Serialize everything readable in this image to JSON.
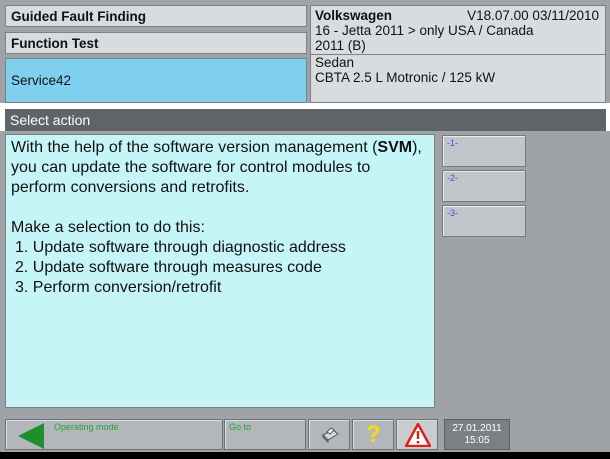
{
  "header": {
    "left": [
      {
        "label": "Guided Fault Finding"
      },
      {
        "label": "Function Test"
      },
      {
        "label": "Service42"
      }
    ],
    "vehicle": {
      "make": "Volkswagen",
      "version": "V18.07.00 03/11/2010",
      "model_line1": "16 - Jetta 2011 > only USA / Canada",
      "model_line2": "2011 (B)",
      "body": "Sedan",
      "engine": "CBTA 2.5 L Motronic / 125 kW"
    }
  },
  "action_bar": {
    "title": "Select action"
  },
  "content": {
    "p1_a": "With the help of the software version management (",
    "p1_b": "SVM",
    "p1_c": "), you can update the software for control modules to perform conversions and retrofits.",
    "p2": "Make a selection to do this:",
    "items": [
      "1. Update software through diagnostic address",
      "2. Update software through measures code",
      "3. Perform conversion/retrofit"
    ]
  },
  "side_buttons": [
    "-1-",
    "-2-",
    "-3-"
  ],
  "footer": {
    "operating_mode": "Operating mode",
    "go_to": "Go to",
    "date": "27.01.2011",
    "time": "15:05"
  },
  "colors": {
    "accent_selected": "#7fcfee",
    "text_panel": "#c6f5f8",
    "back_arrow": "#1f8f2c",
    "help_icon": "#f5e000",
    "warning_icon": "#e0201d"
  },
  "icons": [
    "back-arrow-icon",
    "printer-icon",
    "help-icon",
    "warning-icon"
  ]
}
